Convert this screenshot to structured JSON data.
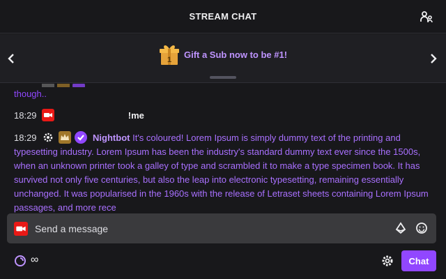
{
  "header": {
    "title": "STREAM CHAT",
    "users_icon": "users-icon"
  },
  "banner": {
    "text": "Gift a Sub now to be #1!",
    "gift_rank": "1",
    "left_icon": "chevron-left-icon",
    "right_icon": "chevron-right-icon",
    "accent": "#bf94ff"
  },
  "messages": {
    "partial": {
      "text": "though.."
    },
    "items": [
      {
        "time": "18:29",
        "badges": [
          "camera-badge"
        ],
        "user": "",
        "text": "!me"
      },
      {
        "time": "18:29",
        "badges": [
          "gear-badge",
          "crown-badge",
          "verified-badge"
        ],
        "user": "Nightbot",
        "text": "It's coloured! Lorem Ipsum is simply dummy text of the printing and typesetting industry. Lorem Ipsum has been the industry's standard dummy text ever since the 1500s, when an unknown printer took a galley of type and scrambled it to make a type specimen book. It has survived not only five centuries, but also the leap into electronic typesetting, remaining essentially unchanged. It was popularised in the 1960s with the release of Letraset sheets containing Lorem Ipsum passages, and more rece"
      }
    ]
  },
  "composer": {
    "placeholder": "Send a message",
    "value": ""
  },
  "footer": {
    "points": "∞",
    "chat_label": "Chat"
  },
  "colors": {
    "background": "#18181b",
    "accent": "#9147ff",
    "message_text": "#a970ff"
  }
}
